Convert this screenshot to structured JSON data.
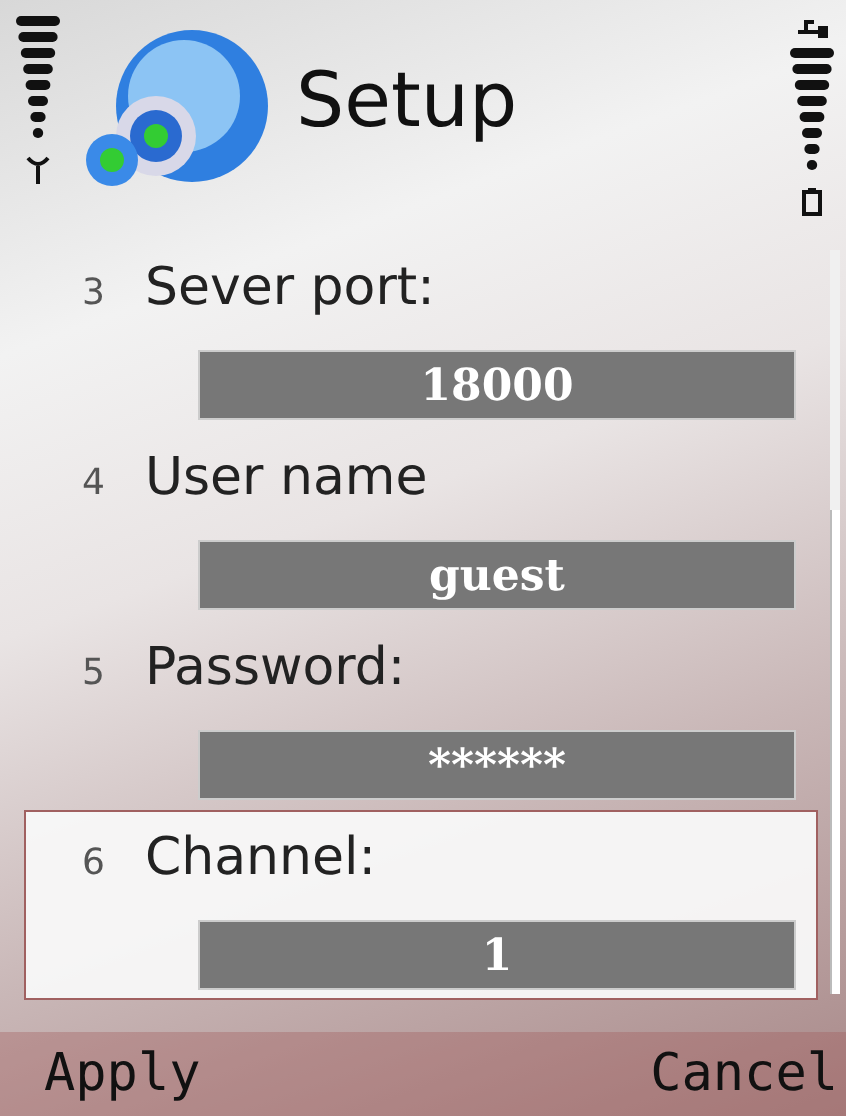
{
  "title": "Setup",
  "fields": [
    {
      "number": "3",
      "label": "Sever port:",
      "value": "18000",
      "selected": false
    },
    {
      "number": "4",
      "label": "User name",
      "value": "guest",
      "selected": false
    },
    {
      "number": "5",
      "label": "Password:",
      "value": "******",
      "selected": false
    },
    {
      "number": "6",
      "label": "Channel:",
      "value": "1",
      "selected": true
    }
  ],
  "softkeys": {
    "left": "Apply",
    "right": "Cancel"
  }
}
